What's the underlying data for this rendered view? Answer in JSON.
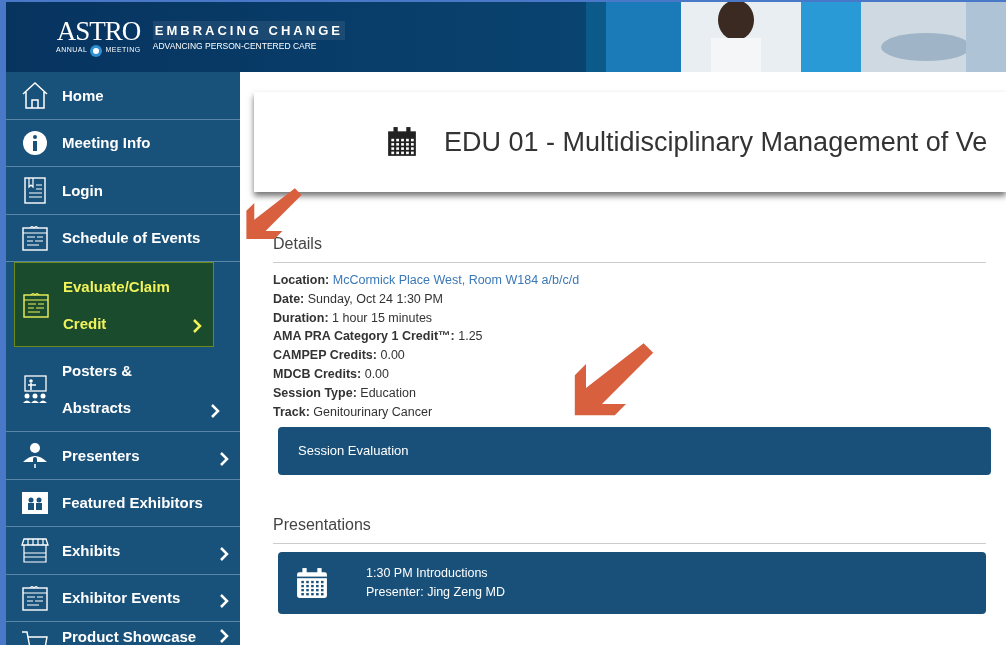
{
  "header": {
    "logo": "ASTRO",
    "logo_left": "ANNUAL",
    "logo_right": "MEETING",
    "tagline": "EMBRACING CHANGE",
    "subtitle": "ADVANCING PERSON-CENTERED CARE"
  },
  "sidebar": {
    "items": [
      {
        "label": "Home",
        "kind": "home",
        "has_submenu": false,
        "selected": false
      },
      {
        "label": "Meeting Info",
        "kind": "info",
        "has_submenu": false,
        "selected": false
      },
      {
        "label": "Login",
        "kind": "login",
        "has_submenu": false,
        "selected": false
      },
      {
        "label": "Schedule of Events",
        "kind": "calendar",
        "has_submenu": false,
        "selected": false
      },
      {
        "label": "Evaluate/Claim Credit",
        "kind": "calendar",
        "has_submenu": true,
        "selected": true
      },
      {
        "label": "Posters & Abstracts",
        "kind": "presenter",
        "has_submenu": true,
        "selected": false
      },
      {
        "label": "Presenters",
        "kind": "person",
        "has_submenu": true,
        "selected": false
      },
      {
        "label": "Featured Exhibitors",
        "kind": "booth",
        "has_submenu": false,
        "selected": false
      },
      {
        "label": "Exhibits",
        "kind": "market",
        "has_submenu": true,
        "selected": false
      },
      {
        "label": "Exhibitor Events",
        "kind": "calendar",
        "has_submenu": true,
        "selected": false
      },
      {
        "label": "Product Showcase",
        "kind": "cart",
        "has_submenu": true,
        "selected": false
      }
    ]
  },
  "session": {
    "title": "EDU 01 - Multidisciplinary Management of Ve",
    "details_heading": "Details",
    "details": [
      {
        "label": "Location:",
        "value": "McCormick Place West, Room W184 a/b/c/d",
        "kind": "link"
      },
      {
        "label": "Date:",
        "value": "Sunday, Oct 24 1:30 PM",
        "kind": "text"
      },
      {
        "label": "Duration:",
        "value": "1 hour 15 minutes",
        "kind": "text"
      },
      {
        "label": "AMA PRA Category 1 Credit™:",
        "value": "1.25",
        "kind": "text"
      },
      {
        "label": "CAMPEP Credits:",
        "value": "0.00",
        "kind": "text"
      },
      {
        "label": "MDCB Credits:",
        "value": "0.00",
        "kind": "text"
      },
      {
        "label": "Session Type:",
        "value": "Education",
        "kind": "text"
      },
      {
        "label": "Track:",
        "value": "Genitourinary Cancer",
        "kind": "text"
      }
    ],
    "evaluation_button": "Session Evaluation",
    "presentations_heading": "Presentations",
    "presentations": [
      {
        "title": "1:30 PM Introductions",
        "presenter": "Presenter: Jing Zeng MD"
      }
    ]
  }
}
